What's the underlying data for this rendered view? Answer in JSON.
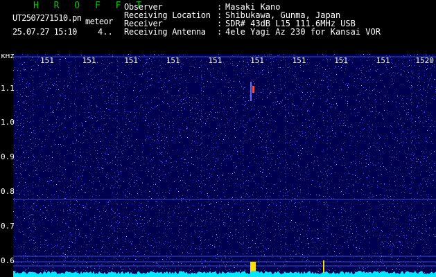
{
  "header": {
    "title": "H R O F F T",
    "filename": "UT2507271510.pn",
    "mode": "meteor",
    "datetime": "25.07.27 15:10",
    "count": "4..",
    "info": [
      {
        "label": "Observer",
        "value": "Masaki Kano"
      },
      {
        "label": "Receiving Location",
        "value": "Shibukawa, Gunma, Japan"
      },
      {
        "label": "Receiver",
        "value": "SDR# 43dB L15 111.6MHz USB"
      },
      {
        "label": "Receiving Antenna",
        "value": "4ele Yagi Az 230 for Kansai VOR"
      }
    ]
  },
  "spectrogram": {
    "y_unit": "kHz",
    "y_ticks": [
      "1.1",
      "1.0",
      "0.9",
      "0.8",
      "0.7",
      "0.6"
    ],
    "x_ticks": [
      "151",
      "151",
      "151",
      "151",
      "151",
      "151",
      "151",
      "151",
      "151",
      "1520"
    ],
    "colors": {
      "background": "#000050",
      "noise": "#3b46d6",
      "echo": "#ff4a4a",
      "trace": "#00e8ff",
      "burst": "#ffe000"
    }
  }
}
